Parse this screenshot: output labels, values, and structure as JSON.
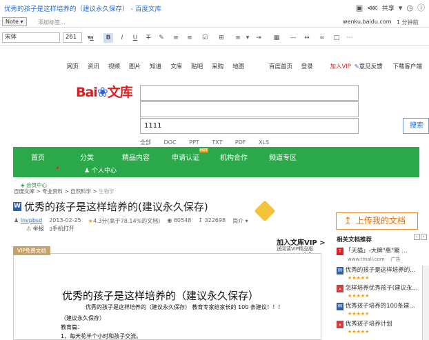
{
  "window": {
    "title": "优秀的孩子是这样培养的（建议永久保存） - 百度文库",
    "share_label": "共享",
    "toolbar_icons": [
      "comment-icon",
      "share-icon",
      "clock-icon",
      "info-icon"
    ],
    "note_label": "Note",
    "add_tag_placeholder": "添加标签...",
    "url": "wenku.baidu.com",
    "updated": "1 分钟前"
  },
  "format_toolbar": {
    "font_family": "宋体",
    "font_size": "261",
    "text_color_label": "a"
  },
  "site_nav": {
    "items": [
      "网页",
      "资讯",
      "视频",
      "图片",
      "知道",
      "文库",
      "贴吧",
      "采购",
      "地图"
    ],
    "right_items": [
      "百度首页",
      "登录",
      "加入VIP",
      "意见反馈",
      "下载客户端"
    ]
  },
  "search": {
    "logo_text": "Bai",
    "logo_suffix": "文库",
    "query": "1111",
    "button": "搜索",
    "doctypes": [
      "全部",
      "DOC",
      "PPT",
      "TXT",
      "PDF",
      "XLS"
    ]
  },
  "green_nav": {
    "tabs": [
      "首页",
      "分类",
      "精品内容",
      "申请认证",
      "机构合作",
      "频道专区"
    ],
    "personal": "个人中心",
    "hot": "HOT"
  },
  "breadcrumb": [
    "百度文库",
    "专业资料",
    "自然科学",
    "生物学"
  ],
  "member_label": "会员中心",
  "document": {
    "title": "优秀的孩子是这样培养的(建议永久保存)",
    "author": "lnvpbsd",
    "date": "2013-02-25",
    "rating": "4.3分(高于78.14%的文档)",
    "views": "60548",
    "downloads": "322698",
    "intro": "简介",
    "report": "举报",
    "mobile": "手机打开",
    "vip_badge": "VIP免费文档",
    "heading": "优秀的孩子是这样培养的（建议永久保存）",
    "line1": "优秀的孩子是这样培养的（建议永久保存） 教育专家给家长的 100 条建议！！！",
    "line2": "（建议永久保存）",
    "line3": "教育篇：",
    "line4": "1、每天花半个小时和孩子交流。"
  },
  "upload_button": "上传我的文档",
  "join_vip": "加入文库VIP >",
  "vip_read": "送阅读VIP精品版",
  "related": {
    "heading": "相关文档推荐",
    "items": [
      {
        "title": "「天猫」-大牌\"惠\"聚 ...",
        "meta": "www.tmall.com",
        "ad": "广告",
        "icon": "tmall-icon"
      },
      {
        "title": "优秀的孩子是这样培养的...",
        "stars": "★★★★★",
        "icon": "word-icon"
      },
      {
        "title": "怎样培养优秀孩子(建议永...",
        "stars": "★★★★★",
        "icon": "pdf-icon"
      },
      {
        "title": "优秀孩子培养的100条建...",
        "stars": "★★★★★",
        "icon": "word-icon"
      },
      {
        "title": "优秀孩子培养计划",
        "stars": "★★★★★",
        "icon": "pdf-icon"
      }
    ]
  }
}
